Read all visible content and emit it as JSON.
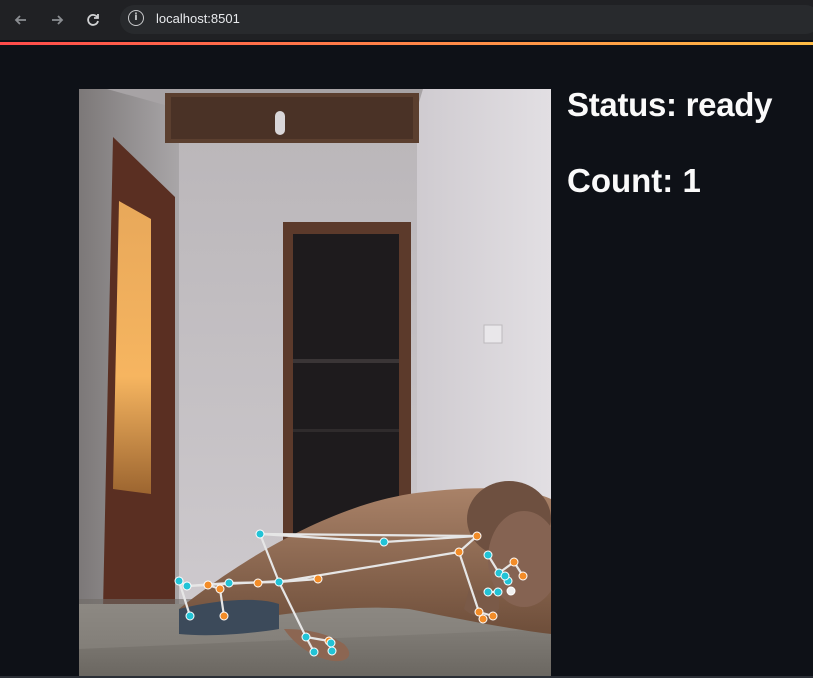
{
  "browser": {
    "url": "localhost:8501",
    "back_icon": "arrow-left-icon",
    "forward_icon": "arrow-right-icon",
    "reload_icon": "reload-icon",
    "info_icon": "info-icon"
  },
  "main": {
    "status_text": "Status: ready",
    "count_text": "Count: 1"
  },
  "colors": {
    "background": "#0e1117",
    "landmark_cyan": "#22c3d6",
    "landmark_orange": "#f28c28",
    "connection": "#e6e6e6"
  }
}
